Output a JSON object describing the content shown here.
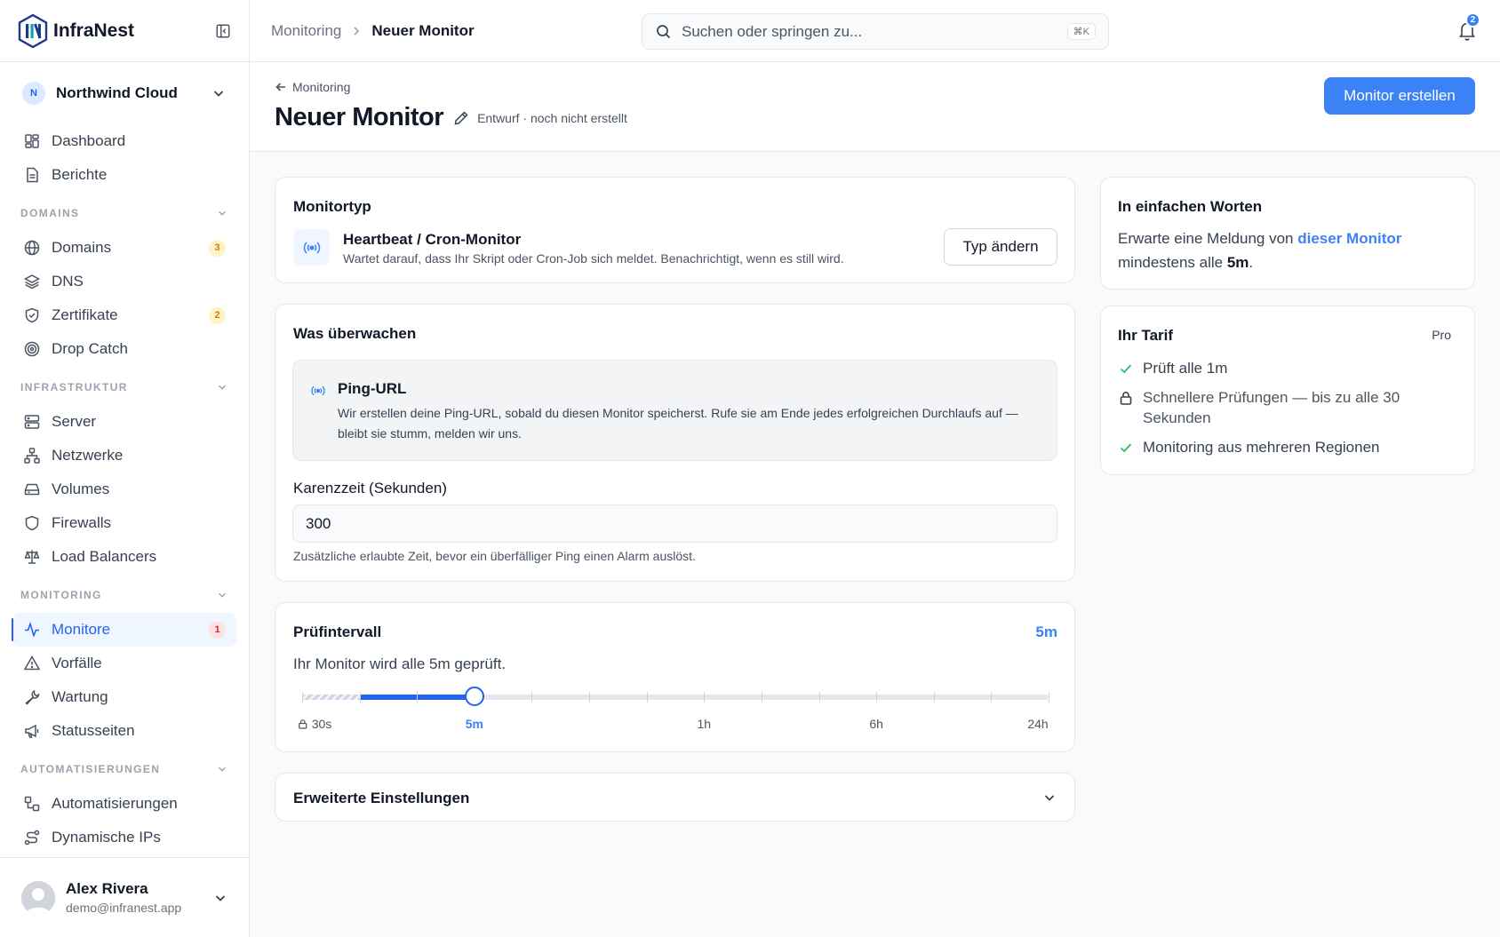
{
  "app": {
    "name": "InfraNest"
  },
  "org": {
    "initial": "N",
    "name": "Northwind Cloud"
  },
  "nav": {
    "top": [
      {
        "label": "Dashboard",
        "icon": "dashboard-icon"
      },
      {
        "label": "Berichte",
        "icon": "report-icon"
      }
    ],
    "domains": {
      "title": "DOMAINS",
      "items": [
        {
          "label": "Domains",
          "icon": "globe-icon",
          "badge": "3"
        },
        {
          "label": "DNS",
          "icon": "layers-icon"
        },
        {
          "label": "Zertifikate",
          "icon": "shield-check-icon",
          "badge": "2"
        },
        {
          "label": "Drop Catch",
          "icon": "target-icon"
        }
      ]
    },
    "infra": {
      "title": "INFRASTRUKTUR",
      "items": [
        {
          "label": "Server",
          "icon": "server-icon"
        },
        {
          "label": "Netzwerke",
          "icon": "network-icon"
        },
        {
          "label": "Volumes",
          "icon": "drive-icon"
        },
        {
          "label": "Firewalls",
          "icon": "shield-icon"
        },
        {
          "label": "Load Balancers",
          "icon": "scale-icon"
        }
      ]
    },
    "monitoring": {
      "title": "MONITORING",
      "items": [
        {
          "label": "Monitore",
          "icon": "activity-icon",
          "badge": "1",
          "active": true
        },
        {
          "label": "Vorfälle",
          "icon": "warning-icon"
        },
        {
          "label": "Wartung",
          "icon": "wrench-icon"
        },
        {
          "label": "Statusseiten",
          "icon": "megaphone-icon"
        }
      ]
    },
    "automation": {
      "title": "AUTOMATISIERUNGEN",
      "items": [
        {
          "label": "Automatisierungen",
          "icon": "workflow-icon"
        },
        {
          "label": "Dynamische IPs",
          "icon": "route-icon"
        }
      ]
    }
  },
  "user": {
    "name": "Alex Rivera",
    "email": "demo@infranest.app"
  },
  "topbar": {
    "breadcrumb_parent": "Monitoring",
    "breadcrumb_current": "Neuer Monitor",
    "search_placeholder": "Suchen oder springen zu...",
    "search_shortcut": "⌘K",
    "notifications_count": "2"
  },
  "page": {
    "back_label": "Monitoring",
    "title": "Neuer Monitor",
    "status": "Entwurf · noch nicht erstellt",
    "create_label": "Monitor erstellen"
  },
  "monitor_type": {
    "title": "Monitortyp",
    "name": "Heartbeat / Cron-Monitor",
    "description": "Wartet darauf, dass Ihr Skript oder Cron-Job sich meldet. Benachrichtigt, wenn es still wird.",
    "change_label": "Typ ändern"
  },
  "watch": {
    "title": "Was überwachen",
    "ping_title": "Ping-URL",
    "ping_desc": "Wir erstellen deine Ping-URL, sobald du diesen Monitor speicherst. Rufe sie am Ende jedes erfolgreichen Durchlaufs auf — bleibt sie stumm, melden wir uns.",
    "grace_label": "Karenzzeit (Sekunden)",
    "grace_value": "300",
    "grace_help": "Zusätzliche erlaubte Zeit, bevor ein überfälliger Ping einen Alarm auslöst."
  },
  "interval": {
    "title": "Prüfintervall",
    "value": "5m",
    "description": "Ihr Monitor wird alle 5m geprüft.",
    "steps": 14,
    "selected_step": 3,
    "locked_until_step": 1,
    "labels": [
      {
        "text": "30s",
        "step": 0,
        "locked": true
      },
      {
        "text": "5m",
        "step": 3,
        "active": true
      },
      {
        "text": "1h",
        "step": 7
      },
      {
        "text": "6h",
        "step": 10
      },
      {
        "text": "24h",
        "step": 13
      }
    ]
  },
  "advanced": {
    "title": "Erweiterte Einstellungen"
  },
  "summary": {
    "title": "In einfachen Worten",
    "text_1": "Erwarte eine Meldung von ",
    "highlight": "dieser Monitor",
    "text_2": " mindestens alle ",
    "interval": "5m",
    "text_3": "."
  },
  "plan": {
    "title": "Ihr Tarif",
    "badge": "Pro",
    "items": [
      {
        "text": "Prüft alle 1m",
        "icon": "check-icon"
      },
      {
        "text": "Schnellere Prüfungen — bis zu alle 30 Sekunden",
        "icon": "lock-icon",
        "locked": true
      },
      {
        "text": "Monitoring aus mehreren Regionen",
        "icon": "check-icon"
      }
    ]
  },
  "colors": {
    "accent": "#3b82f6",
    "accent_dark": "#2563eb",
    "success": "#22c55e"
  }
}
